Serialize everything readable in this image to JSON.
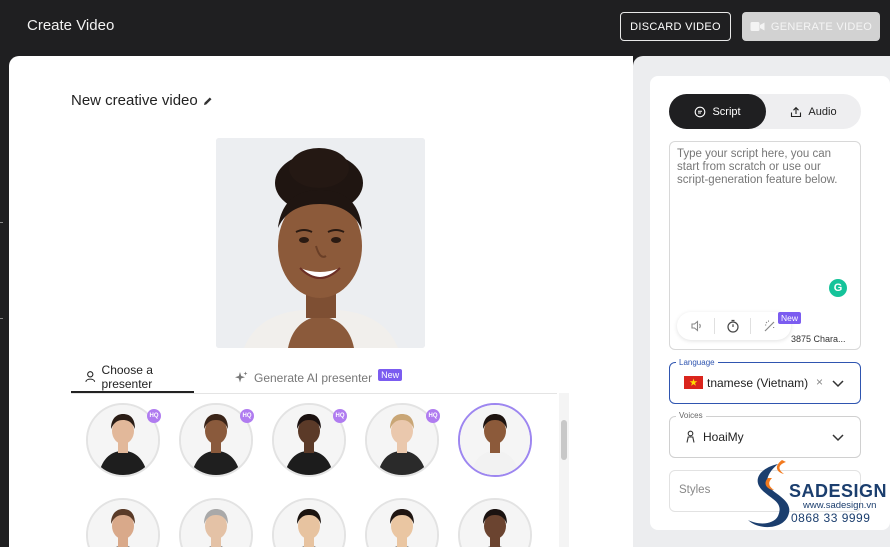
{
  "header": {
    "title": "Create Video",
    "discard_label": "DISCARD VIDEO",
    "generate_label": "GENERATE VIDEO"
  },
  "editor": {
    "video_title": "New creative video",
    "tabs": {
      "choose_presenter": "Choose a presenter",
      "generate_ai": "Generate AI presenter",
      "new_badge": "New"
    },
    "presenters": [
      {
        "row": 0,
        "hq": true,
        "selected": false,
        "skin": "#e2b89a",
        "hair": "#2a1d16",
        "outfit": "#1e1e1e"
      },
      {
        "row": 0,
        "hq": true,
        "selected": false,
        "skin": "#8a5a3c",
        "hair": "#3a2418",
        "outfit": "#1f1f1f"
      },
      {
        "row": 0,
        "hq": true,
        "selected": false,
        "skin": "#5b3a28",
        "hair": "#1a1110",
        "outfit": "#1c1c1c"
      },
      {
        "row": 0,
        "hq": true,
        "selected": false,
        "skin": "#eac8ad",
        "hair": "#c9a676",
        "outfit": "#2a2a2a"
      },
      {
        "row": 0,
        "hq": false,
        "selected": true,
        "skin": "#8c5a3a",
        "hair": "#1e1410",
        "outfit": "#f2f2f2"
      },
      {
        "row": 1,
        "hq": false,
        "selected": false,
        "skin": "#d9a98a",
        "hair": "#5a3b28",
        "outfit": "#3a3a3a"
      },
      {
        "row": 1,
        "hq": false,
        "selected": false,
        "skin": "#e4c2a6",
        "hair": "#a9a9a9",
        "outfit": "#444"
      },
      {
        "row": 1,
        "hq": false,
        "selected": false,
        "skin": "#e7c3a0",
        "hair": "#1b1410",
        "outfit": "#444"
      },
      {
        "row": 1,
        "hq": false,
        "selected": false,
        "skin": "#eac6a2",
        "hair": "#201612",
        "outfit": "#444"
      },
      {
        "row": 1,
        "hq": false,
        "selected": false,
        "skin": "#6b4430",
        "hair": "#1b1311",
        "outfit": "#444"
      }
    ],
    "hq_label": "HQ"
  },
  "side": {
    "tab_script": "Script",
    "tab_audio": "Audio",
    "script_placeholder": "Type your script here, you can start from scratch or use our script-generation feature below.",
    "grammarly_letter": "G",
    "tools_new_badge": "New",
    "char_count": "3875 Chara...",
    "language_label": "Language",
    "language_value": "tnamese (Vietnam)",
    "language_clear": "×",
    "voices_label": "Voices",
    "voice_value": "HoaiMy",
    "styles_placeholder": "Styles"
  },
  "watermark": {
    "brand": "SADESIGN",
    "url": "www.sadesign.vn",
    "phone": "0868 33 9999"
  },
  "colors": {
    "accent": "#7b5cf0",
    "focus_blue": "#2f55b0",
    "dark": "#1f1f21"
  }
}
